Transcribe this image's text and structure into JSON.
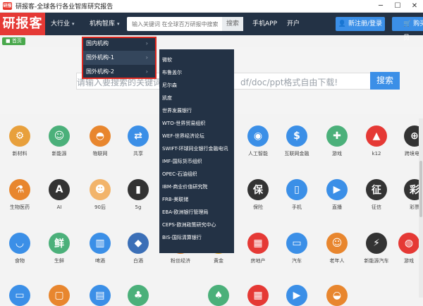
{
  "window": {
    "title": "研报客-全球各行各业智库研究报告",
    "app_icon_text": "研报"
  },
  "nav": {
    "logo": "研报客",
    "items": [
      {
        "label": "大行业",
        "caret": "▾"
      },
      {
        "label": "机构智库",
        "caret": "▾"
      },
      {
        "label": "手机APP"
      },
      {
        "label": "开户"
      }
    ],
    "search_placeholder": "输入关键词 在全球百万研报中搜索",
    "search_button": "搜索",
    "register_button": "新注册/登录",
    "vip_button": "购买会员"
  },
  "breadcrumb": "首页",
  "banner_search": {
    "placeholder_left": "请输入要搜索的关键词 在",
    "placeholder_right": "df/doc/ppt格式自由下载!",
    "button": "搜索"
  },
  "menu1": {
    "items": [
      {
        "label": "国内机构"
      },
      {
        "label": "国外机构-1"
      },
      {
        "label": "国外机构-2"
      }
    ]
  },
  "menu2": {
    "items": [
      "微软",
      "布鲁盖尔",
      "尼尔森",
      "凯度",
      "世界发展银行",
      "WTO-世界贸易组织",
      "WEF-世界经济论坛",
      "SWIFT-环球同业银行金融电讯",
      "IMF-国际货币组织",
      "OPEC-石油组织",
      "IBM-商业价值研究院",
      "FRB-美联储",
      "EBA-欧洲银行管理局",
      "CEPS-欧洲政策研究中心",
      "BIS-国际清算银行"
    ]
  },
  "categories": {
    "row1": [
      {
        "label": "新材料",
        "icon": "chain-icon",
        "color": "#e8a03c"
      },
      {
        "label": "新能源",
        "icon": "worker-icon",
        "color": "#4bb07a"
      },
      {
        "label": "物联网",
        "icon": "helmet-icon",
        "color": "#e8862e"
      },
      {
        "label": "共享",
        "icon": "share-icon",
        "color": "#3b8fe7"
      },
      {
        "label": "人工智能",
        "icon": "robot-icon",
        "color": "#3b8fe7"
      },
      {
        "label": "互联网金融",
        "icon": "dollar-icon",
        "color": "#3b8fe7"
      },
      {
        "label": "游戏",
        "icon": "gamepad-icon",
        "color": "#4bb07a"
      },
      {
        "label": "k12",
        "icon": "graduation-icon",
        "color": "#e53935"
      },
      {
        "label": "跨境电商",
        "icon": "cart-icon",
        "color": "#333333"
      }
    ],
    "row2": [
      {
        "label": "生物医药",
        "icon": "mortar-icon",
        "color": "#e8862e"
      },
      {
        "label": "AI",
        "icon": "ai-icon",
        "color": "#333333"
      },
      {
        "label": "90后",
        "icon": "person-icon",
        "color": "#f2b46b"
      },
      {
        "label": "5g",
        "icon": "signal-icon",
        "color": "#333333"
      },
      {
        "label": "保险",
        "icon": "insurance-icon",
        "color": "#333333"
      },
      {
        "label": "手机",
        "icon": "phone-icon",
        "color": "#3b8fe7"
      },
      {
        "label": "直播",
        "icon": "live-icon",
        "color": "#3b8fe7"
      },
      {
        "label": "征信",
        "icon": "credit-icon",
        "color": "#333333"
      },
      {
        "label": "彩票",
        "icon": "lottery-icon",
        "color": "#333333"
      }
    ],
    "row3": [
      {
        "label": "食物",
        "icon": "bowl-icon",
        "color": "#3b8fe7"
      },
      {
        "label": "生鲜",
        "icon": "fresh-icon",
        "color": "#4bb07a"
      },
      {
        "label": "啤酒",
        "icon": "beer-icon",
        "color": "#3b8fe7"
      },
      {
        "label": "白酒",
        "icon": "liquor-icon",
        "color": "#3b6fb7"
      },
      {
        "label": "粉丝经济",
        "icon": "fans-icon",
        "color": "#e8862e"
      },
      {
        "label": "黄金",
        "icon": "gold-icon",
        "color": "#f2b42b"
      },
      {
        "label": "房地产",
        "icon": "building-icon",
        "color": "#e53935"
      },
      {
        "label": "汽车",
        "icon": "car-icon",
        "color": "#3b8fe7"
      },
      {
        "label": "老年人",
        "icon": "elder-icon",
        "color": "#e8862e"
      },
      {
        "label": "新能源汽车",
        "icon": "ev-icon",
        "color": "#333333"
      },
      {
        "label": "游戏",
        "icon": "console-icon",
        "color": "#e53935"
      }
    ]
  },
  "colors": {
    "nav_bg": "#233245",
    "logo_bg": "#e53935",
    "accent": "#3b8fe7",
    "highlight_box": "#e0271e"
  }
}
